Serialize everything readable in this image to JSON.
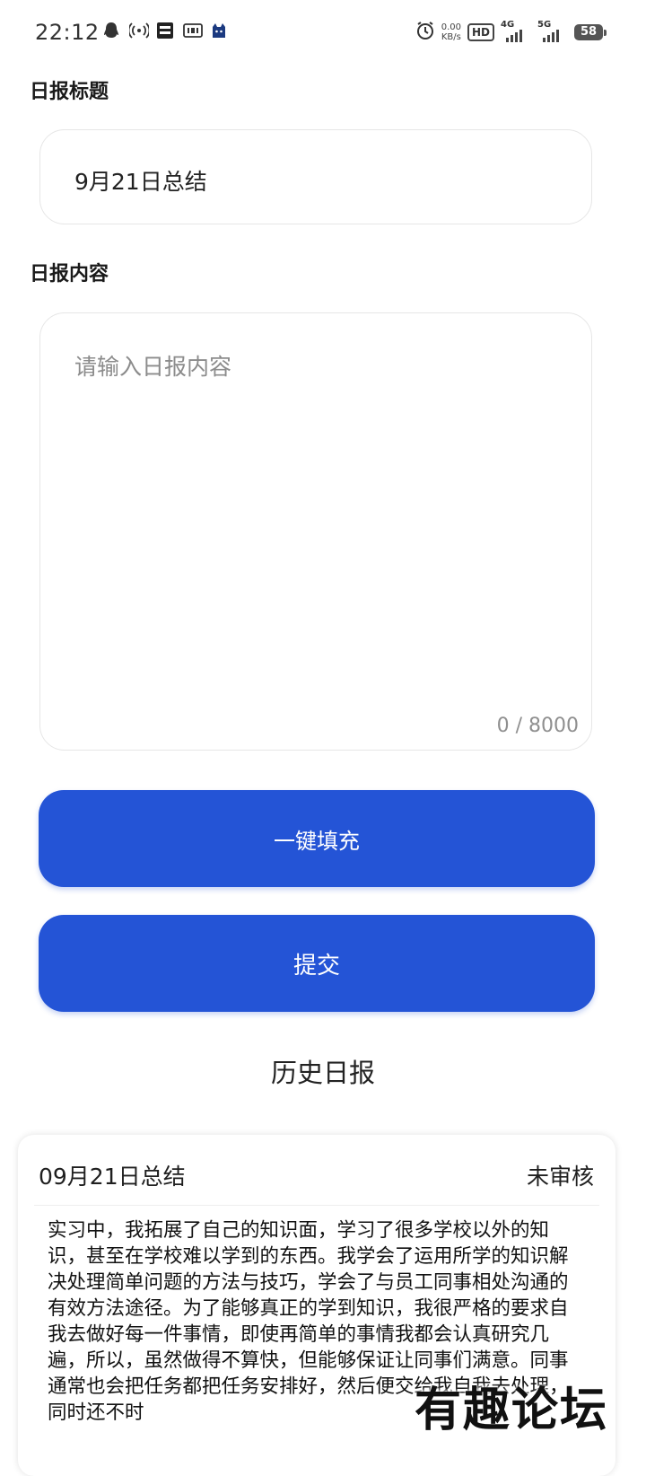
{
  "status_bar": {
    "time": "22:12",
    "speed_value": "0.00",
    "speed_unit": "KB/s",
    "hd_label": "HD",
    "net1_label": "4G",
    "net2_label": "5G",
    "battery": "58",
    "icons": [
      "qq-icon",
      "hotspot-icon",
      "app-icon",
      "iqiyi-icon",
      "cat-icon",
      "alarm-icon"
    ]
  },
  "form": {
    "title_label": "日报标题",
    "title_value": "9月21日总结",
    "content_label": "日报内容",
    "content_placeholder": "请输入日报内容",
    "counter": "0 / 8000"
  },
  "buttons": {
    "fill_label": "一键填充",
    "submit_label": "提交"
  },
  "history": {
    "title": "历史日报",
    "items": [
      {
        "date": "09月21日总结",
        "status": "未审核",
        "content": "实习中，我拓展了自己的知识面，学习了很多学校以外的知识，甚至在学校难以学到的东西。我学会了运用所学的知识解决处理简单问题的方法与技巧，学会了与员工同事相处沟通的有效方法途径。为了能够真正的学到知识，我很严格的要求自我去做好每一件事情，即使再简单的事情我都会认真研究几遍，所以，虽然做得不算快，但能够保证让同事们满意。同事通常也会把任务都把任务安排好，然后便交给我自我去处理，同时还不时"
      }
    ]
  },
  "watermark": "有趣论坛",
  "colors": {
    "accent": "#2454d6",
    "placeholder": "#8c8c8c",
    "border": "#e6e6e6"
  }
}
